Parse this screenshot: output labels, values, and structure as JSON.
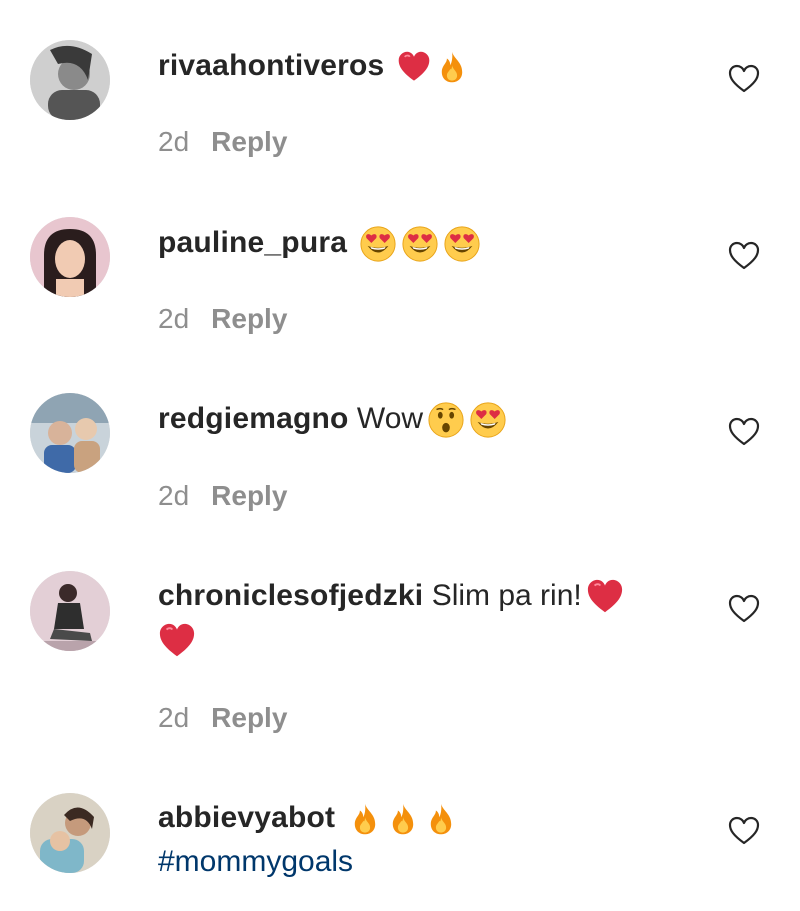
{
  "comments": [
    {
      "username": "rivaahontiveros",
      "text": "",
      "emojis": [
        "red-heart",
        "fire"
      ],
      "second_line": "",
      "time": "2d",
      "reply_label": "Reply"
    },
    {
      "username": "pauline_pura",
      "text": "",
      "emojis": [
        "heart-eyes",
        "heart-eyes",
        "heart-eyes"
      ],
      "second_line": "",
      "time": "2d",
      "reply_label": "Reply"
    },
    {
      "username": "redgiemagno",
      "text": "Wow",
      "emojis": [
        "astonished-face",
        "heart-eyes"
      ],
      "second_line": "",
      "time": "2d",
      "reply_label": "Reply"
    },
    {
      "username": "chroniclesofjedzki",
      "text": "Slim pa rin!",
      "emojis": [
        "red-heart"
      ],
      "second_line_emojis": [
        "red-heart"
      ],
      "time": "2d",
      "reply_label": "Reply"
    },
    {
      "username": "abbievyabot",
      "text": "",
      "emojis": [
        "fire",
        "fire",
        "fire"
      ],
      "hashtag": "#mommygoals"
    }
  ],
  "colors": {
    "text": "#262626",
    "muted": "#8e8e8e",
    "hashtag": "#00376b"
  }
}
